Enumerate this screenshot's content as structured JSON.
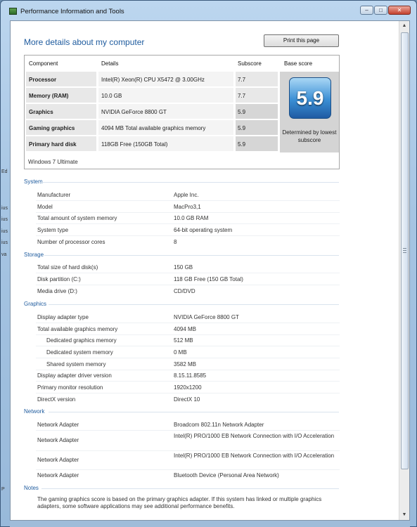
{
  "window": {
    "title": "Performance Information and Tools",
    "min": "–",
    "max": "□",
    "close": "✕"
  },
  "behind_text": [
    "Ed",
    "ius",
    "ius",
    "ius",
    "ius",
    "va",
    "P"
  ],
  "heading": "More details about my computer",
  "print_label": "Print this page",
  "score_headers": {
    "component": "Component",
    "details": "Details",
    "subscore": "Subscore",
    "base": "Base score"
  },
  "scores": [
    {
      "component": "Processor",
      "details": "Intel(R) Xeon(R) CPU X5472 @ 3.00GHz",
      "subscore": "7.7"
    },
    {
      "component": "Memory (RAM)",
      "details": "10.0 GB",
      "subscore": "7.7"
    },
    {
      "component": "Graphics",
      "details": "NVIDIA GeForce 8800 GT",
      "subscore": "5.9"
    },
    {
      "component": "Gaming graphics",
      "details": "4094 MB Total available graphics memory",
      "subscore": "5.9"
    },
    {
      "component": "Primary hard disk",
      "details": "118GB Free (150GB Total)",
      "subscore": "5.9"
    }
  ],
  "base_score": "5.9",
  "base_caption": "Determined by lowest subscore",
  "os_name": "Windows 7 Ultimate",
  "sections": {
    "system": {
      "title": "System",
      "rows": [
        {
          "label": "Manufacturer",
          "value": "Apple Inc."
        },
        {
          "label": "Model",
          "value": "MacPro3,1"
        },
        {
          "label": "Total amount of system memory",
          "value": "10.0 GB RAM"
        },
        {
          "label": "System type",
          "value": "64-bit operating system"
        },
        {
          "label": "Number of processor cores",
          "value": "8"
        }
      ]
    },
    "storage": {
      "title": "Storage",
      "rows": [
        {
          "label": "Total size of hard disk(s)",
          "value": "150 GB"
        },
        {
          "label": "Disk partition (C:)",
          "value": "118 GB Free (150 GB Total)"
        },
        {
          "label": "Media drive (D:)",
          "value": "CD/DVD"
        }
      ]
    },
    "graphics": {
      "title": "Graphics",
      "rows": [
        {
          "label": "Display adapter type",
          "value": "NVIDIA GeForce 8800 GT"
        },
        {
          "label": "Total available graphics memory",
          "value": "4094 MB"
        },
        {
          "label": "Dedicated graphics memory",
          "value": "512 MB"
        },
        {
          "label": "Dedicated system memory",
          "value": "0 MB"
        },
        {
          "label": "Shared system memory",
          "value": "3582 MB"
        },
        {
          "label": "Display adapter driver version",
          "value": "8.15.11.8585"
        },
        {
          "label": "Primary monitor resolution",
          "value": "1920x1200"
        },
        {
          "label": "DirectX version",
          "value": "DirectX 10"
        }
      ]
    },
    "network": {
      "title": "Network",
      "rows": [
        {
          "label": "Network Adapter",
          "value": "Broadcom 802.11n Network Adapter"
        },
        {
          "label": "Network Adapter",
          "value": "Intel(R) PRO/1000 EB Network Connection with I/O Acceleration"
        },
        {
          "label": "Network Adapter",
          "value": "Intel(R) PRO/1000 EB Network Connection with I/O Acceleration"
        },
        {
          "label": "Network Adapter",
          "value": "Bluetooth Device (Personal Area Network)"
        }
      ]
    },
    "notes": {
      "title": "Notes",
      "text": "The gaming graphics score is based on the primary graphics adapter. If this system has linked or multiple graphics adapters, some software applications may see additional performance benefits."
    }
  },
  "scrollbar": {
    "up": "▲",
    "down": "▼"
  }
}
